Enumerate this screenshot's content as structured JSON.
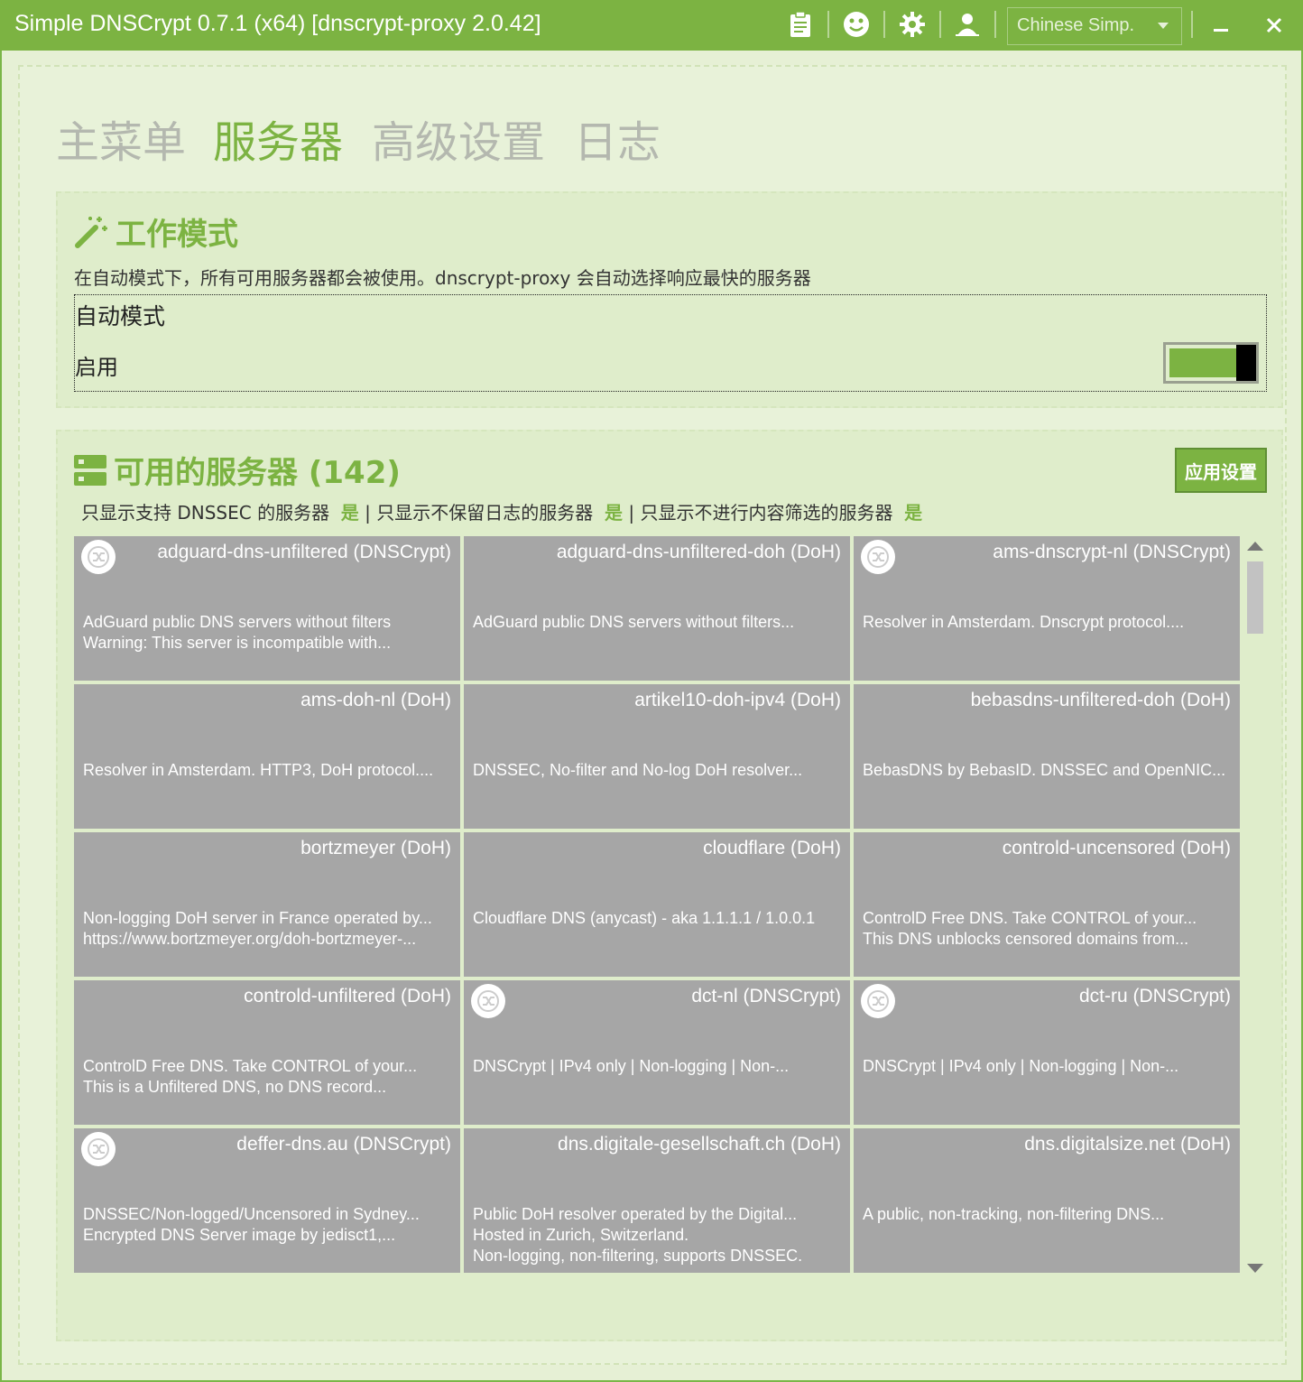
{
  "window": {
    "title": "Simple DNSCrypt 0.7.1 (x64) [dnscrypt-proxy 2.0.42]",
    "language": "Chinese Simp.",
    "titlebar_icons": [
      "clipboard-icon",
      "smiley-icon",
      "gear-icon",
      "user-icon"
    ]
  },
  "nav": {
    "tabs": [
      {
        "label": "主菜单",
        "active": false
      },
      {
        "label": "服务器",
        "active": true
      },
      {
        "label": "高级设置",
        "active": false
      },
      {
        "label": "日志",
        "active": false
      }
    ]
  },
  "work_mode": {
    "title": "工作模式",
    "description": "在自动模式下，所有可用服务器都会被使用。dnscrypt-proxy 会自动选择响应最快的服务器",
    "mode_label": "自动模式",
    "enable_label": "启用",
    "enabled": true
  },
  "servers": {
    "title": "可用的服务器 (142)",
    "apply_button": "应用设置",
    "filters": {
      "dnssec_label": "只显示支持 DNSSEC 的服务器",
      "dnssec_value": "是",
      "sep1": "|",
      "nolog_label": "只显示不保留日志的服务器",
      "nolog_value": "是",
      "sep2": "|",
      "nofilter_label": "只显示不进行内容筛选的服务器",
      "nofilter_value": "是"
    },
    "list": [
      {
        "name": "adguard-dns-unfiltered (DNSCrypt)",
        "desc": "AdGuard public DNS servers without filters\nWarning: This server is incompatible with...",
        "icon": true
      },
      {
        "name": "adguard-dns-unfiltered-doh (DoH)",
        "desc": "AdGuard public DNS servers without filters...",
        "icon": false
      },
      {
        "name": "ams-dnscrypt-nl (DNSCrypt)",
        "desc": "Resolver in Amsterdam. Dnscrypt protocol....",
        "icon": true
      },
      {
        "name": "ams-doh-nl (DoH)",
        "desc": "Resolver in Amsterdam. HTTP3, DoH protocol....",
        "icon": false
      },
      {
        "name": "artikel10-doh-ipv4 (DoH)",
        "desc": "DNSSEC, No-filter and No-log DoH resolver...",
        "icon": false
      },
      {
        "name": "bebasdns-unfiltered-doh (DoH)",
        "desc": "BebasDNS by BebasID. DNSSEC and OpenNIC...",
        "icon": false
      },
      {
        "name": "bortzmeyer (DoH)",
        "desc": "Non-logging DoH server in France operated by...\nhttps://www.bortzmeyer.org/doh-bortzmeyer-...",
        "icon": false
      },
      {
        "name": "cloudflare (DoH)",
        "desc": "Cloudflare DNS (anycast) - aka 1.1.1.1 / 1.0.0.1",
        "icon": false
      },
      {
        "name": "controld-uncensored (DoH)",
        "desc": "ControlD Free DNS. Take CONTROL of your...\nThis DNS unblocks censored domains from...",
        "icon": false
      },
      {
        "name": "controld-unfiltered (DoH)",
        "desc": "ControlD Free DNS. Take CONTROL of your...\nThis is a Unfiltered DNS, no DNS record...",
        "icon": false
      },
      {
        "name": "dct-nl (DNSCrypt)",
        "desc": "DNSCrypt | IPv4 only | Non-logging | Non-...",
        "icon": true
      },
      {
        "name": "dct-ru (DNSCrypt)",
        "desc": "DNSCrypt | IPv4 only | Non-logging | Non-...",
        "icon": true
      },
      {
        "name": "deffer-dns.au (DNSCrypt)",
        "desc": "DNSSEC/Non-logged/Uncensored in Sydney...\nEncrypted DNS Server image by jedisct1,...",
        "icon": true
      },
      {
        "name": "dns.digitale-gesellschaft.ch (DoH)",
        "desc": "Public DoH resolver operated by the Digital...\nHosted in Zurich, Switzerland.\nNon-logging, non-filtering, supports DNSSEC.",
        "icon": false
      },
      {
        "name": "dns.digitalsize.net (DoH)",
        "desc": "A public, non-tracking, non-filtering DNS...",
        "icon": false
      }
    ]
  }
}
